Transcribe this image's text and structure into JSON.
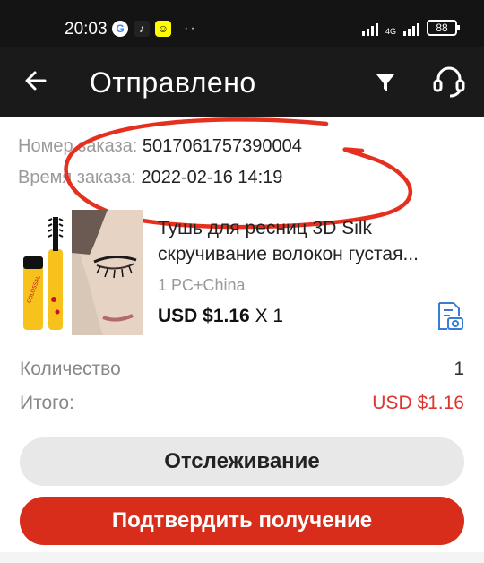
{
  "status_bar": {
    "time": "20:03",
    "network": "4G",
    "battery": "88",
    "app_icons": [
      "google-icon",
      "tiktok-icon",
      "snapchat-icon"
    ]
  },
  "header": {
    "title": "Отправлено",
    "icons": [
      "back-arrow-icon",
      "filter-icon",
      "headset-icon"
    ]
  },
  "order": {
    "number_label": "Номер заказа:",
    "number": "5017061757390004",
    "time_label": "Время заказа:",
    "time": "2022-02-16 14:19"
  },
  "product": {
    "title_line1": "Тушь для ресниц 3D Silk",
    "title_line2": "скручивание волокон густая...",
    "sku": "1 PC+China",
    "price": "USD $1.16",
    "qty": "X 1"
  },
  "summary": {
    "quantity_label": "Количество",
    "quantity": "1",
    "total_label": "Итого:",
    "total": "USD $1.16"
  },
  "buttons": {
    "track": "Отслеживание",
    "confirm": "Подтвердить получение"
  },
  "colors": {
    "header_bg": "#1a1a1a",
    "accent_red": "#d72d1a",
    "total_red": "#e0342f",
    "annotation_red": "#e5301f"
  }
}
